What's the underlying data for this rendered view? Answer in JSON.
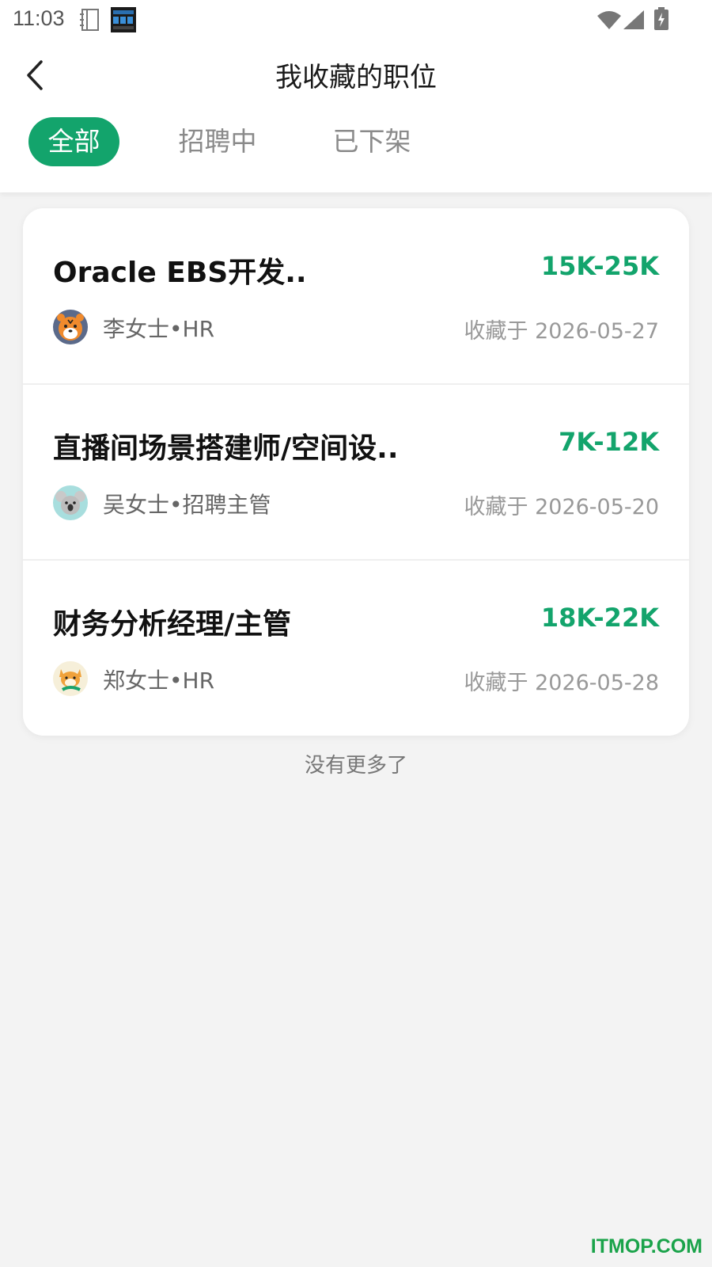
{
  "status_bar": {
    "time": "11:03",
    "icons": [
      "notebook-icon",
      "clock-widget-icon",
      "wifi-icon",
      "signal-icon",
      "battery-charging-icon"
    ]
  },
  "header": {
    "title": "我收藏的职位",
    "back_icon": "chevron-left-icon"
  },
  "tabs": [
    {
      "label": "全部",
      "active": true
    },
    {
      "label": "招聘中",
      "active": false
    },
    {
      "label": "已下架",
      "active": false
    }
  ],
  "jobs": [
    {
      "title": "Oracle EBS开发..",
      "salary": "15K-25K",
      "recruiter": "李女士•HR",
      "saved": "收藏于 2026-05-27",
      "avatar_icon": "tiger-avatar-icon"
    },
    {
      "title": "直播间场景搭建师/空间设..",
      "salary": "7K-12K",
      "recruiter": "吴女士•招聘主管",
      "saved": "收藏于 2026-05-20",
      "avatar_icon": "koala-avatar-icon"
    },
    {
      "title": "财务分析经理/主管",
      "salary": "18K-22K",
      "recruiter": "郑女士•HR",
      "saved": "收藏于 2026-05-28",
      "avatar_icon": "shiba-avatar-icon"
    }
  ],
  "footer": {
    "no_more": "没有更多了"
  },
  "watermark": "ITMOP.COM",
  "colors": {
    "accent": "#13a46c",
    "background": "#f3f3f3"
  }
}
